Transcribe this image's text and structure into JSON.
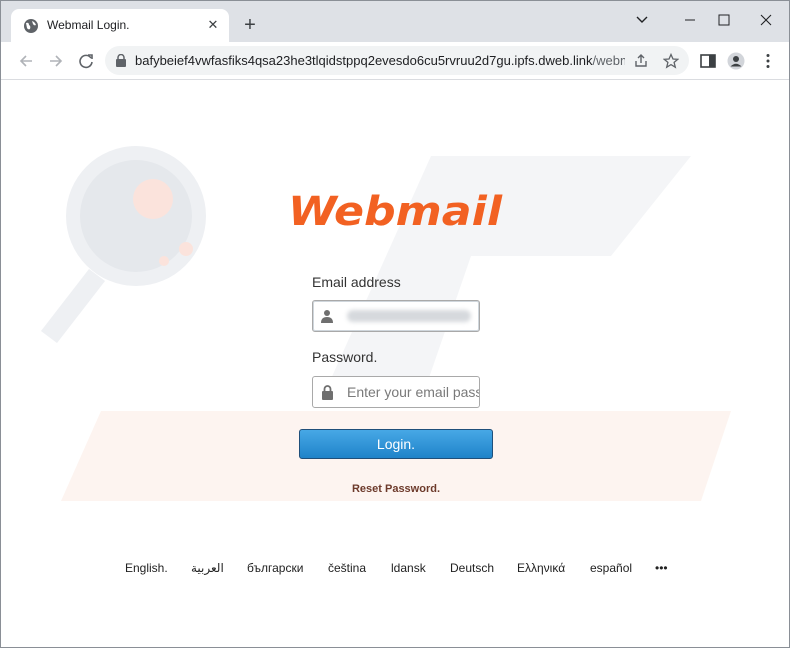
{
  "browser": {
    "tab_title": "Webmail Login.",
    "new_tab": "+",
    "url_host": "bafybeief4vwfasfiks4qsa23he3tlqidstppq2evesdo6cu5rvruu2d7gu.ipfs.dweb.link",
    "url_path": "/webm...",
    "icons": [
      "globe-icon",
      "close-icon",
      "back-icon",
      "forward-icon",
      "reload-icon",
      "lock-icon",
      "share-icon",
      "star-icon",
      "sidebar-icon",
      "profile-icon",
      "menu-icon"
    ]
  },
  "login": {
    "logo_text": "Webmail",
    "email_label": "Email address",
    "password_label": "Password.",
    "password_placeholder": "Enter your email password",
    "login_button": "Login.",
    "reset_link": "Reset Password.",
    "accent_color": "#f26122",
    "button_color": "#2b8fd6"
  },
  "languages": [
    "English.",
    "العربية",
    "български",
    "čeština",
    "ldansk",
    "Deutsch",
    "Ελληνικά",
    "español",
    "•••"
  ]
}
